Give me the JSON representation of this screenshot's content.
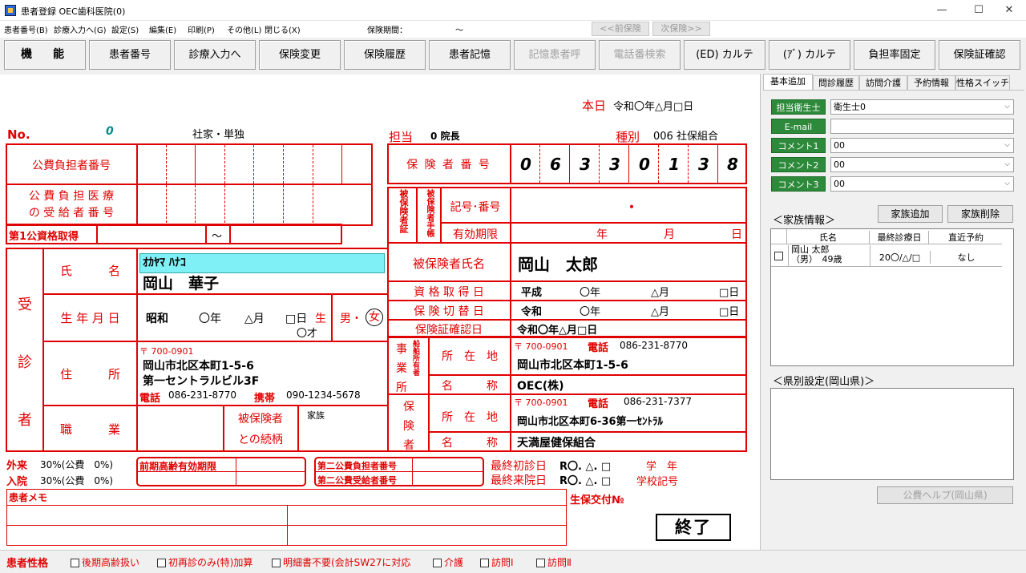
{
  "window": {
    "title": "患者登録  OEC歯科医院(0)",
    "min": "—",
    "max": "☐",
    "close": "✕"
  },
  "menu": {
    "items": [
      "患者番号(B)",
      "診療入力へ(G)",
      "設定(S)",
      "編集(E)",
      "印刷(P)",
      "その他(L)",
      "閉じる(X)"
    ],
    "period_label": "保険期間：",
    "period_sep": "～",
    "prev": "<<前保険",
    "next": "次保険>>"
  },
  "toolbar": {
    "function": "機　能",
    "buttons": [
      "患者番号",
      "診療入力へ",
      "保険変更",
      "保険履歴",
      "患者記憶",
      "記憶患者呼",
      "電話番検索",
      "(ED) カルテ",
      "(ｱﾞ) カルテ",
      "負担率固定",
      "保険証確認"
    ]
  },
  "header": {
    "today_label": "本日",
    "today_value": "令和〇年△月□日",
    "no_label": "No.",
    "no_value": "0",
    "type_left": "社家・単独",
    "tantou_label": "担当",
    "tantou_value": "0 院長",
    "shubetsu_label": "種別",
    "shubetsu_value": "006 社保組合"
  },
  "public": {
    "payer_label": "公費負担者番号",
    "recipient_label_1": "公 費 負 担 医 療",
    "recipient_label_2": "の 受 給 者 番 号",
    "first_label": "第1公資格取得",
    "first_sep": "～"
  },
  "insurer": {
    "label": "保 険 者 番 号",
    "digits": [
      "0",
      "6",
      "3",
      "3",
      "0",
      "1",
      "3",
      "8"
    ]
  },
  "insured": {
    "side_label": "被保険者証",
    "side_label2": "被保険者手帳",
    "kigo_label": "記号･番号",
    "kigo_value": "・",
    "valid_label": "有効期限",
    "valid_y": "年",
    "valid_m": "月",
    "valid_d": "日",
    "name_label": "被保険者氏名",
    "name_value": "岡山　太郎",
    "acq_label": "資 格 取 得 日",
    "acq_era": "平成",
    "acq_y": "〇年",
    "acq_m": "△月",
    "acq_d": "□日",
    "switch_label": "保 険 切 替 日",
    "sw_era": "令和",
    "sw_y": "〇年",
    "sw_m": "△月",
    "sw_d": "□日",
    "confirm_label": "保険証確認日",
    "confirm_value": "令和〇年△月□日"
  },
  "patient": {
    "side_label": [
      "受",
      "診",
      "者"
    ],
    "name_label": "氏　　　名",
    "kana_value": "ｵｶﾔﾏ ﾊﾅｺ",
    "name_value": "岡山　華子",
    "dob_label": "生 年 月 日",
    "dob_era": "昭和",
    "dob_y": "〇年",
    "dob_m": "△月",
    "dob_d": "□日",
    "dob_birth": "生",
    "age": "〇才",
    "sex_male": "男・",
    "sex_female": "女",
    "addr_label": "住　　　所",
    "zip": "〒 700-0901",
    "addr1": "岡山市北区本町1-5-6",
    "addr2": "第一セントラルビル3F",
    "tel_label": "電話",
    "tel_value": "086-231-8770",
    "mobile_label": "携帯",
    "mobile_value": "090-1234-5678",
    "job_label": "職　　　業",
    "relation_label_1": "被保険者",
    "relation_label_2": "との続柄",
    "relation_value": "家族"
  },
  "employer": {
    "side_label": [
      "事",
      "業",
      "所"
    ],
    "side_label2": "船舶所有者",
    "addr_label": "所　在　地",
    "zip": "〒 700-0901",
    "tel_label": "電話",
    "tel_value": "086-231-8770",
    "addr": "岡山市北区本町1-5-6",
    "name_label": "名　　　称",
    "name_value": "OEC(株)"
  },
  "insurer_info": {
    "side_label": [
      "保",
      "険",
      "者"
    ],
    "addr_label": "所　在　地",
    "zip": "〒 700-0901",
    "tel_label": "電話",
    "tel_value": "086-231-7377",
    "addr": "岡山市北区本町6-36第一ｾﾝﾄﾗﾙ",
    "name_label": "名　　　称",
    "name_value": "天満屋健保組合"
  },
  "bottom": {
    "gairai_label": "外来",
    "gairai_value": "30%(公費　0%)",
    "nyuin_label": "入院",
    "nyuin_value": "30%(公費　0%)",
    "koki_label": "前期高齢有効期限",
    "second_payer": "第二公費負担者番号",
    "second_recipient": "第二公費受給者番号",
    "last_first_label": "最終初診日",
    "last_first_value": "R〇. △. □",
    "last_visit_label": "最終来院日",
    "last_visit_value": "R〇. △. □",
    "gakunen": "学　年",
    "school": "学校記号",
    "memo_label": "患者メモ",
    "shiho": "生保交付№",
    "end_btn": "終了"
  },
  "right": {
    "tabs": [
      "基本追加",
      "問診履歴",
      "訪問介護",
      "予約情報",
      "性格スイッチ"
    ],
    "rows": [
      {
        "label": "担当衛生士",
        "value": "衛生士0"
      },
      {
        "label": "E-mail",
        "value": ""
      },
      {
        "label": "コメント1",
        "value": "00"
      },
      {
        "label": "コメント2",
        "value": "00"
      },
      {
        "label": "コメント3",
        "value": "00"
      }
    ],
    "family_label": "＜家族情報＞",
    "family_add": "家族追加",
    "family_del": "家族削除",
    "family_cols": [
      "氏名",
      "最終診療日",
      "直近予約"
    ],
    "family_row": {
      "name1": "岡山 太郎",
      "name2": "（男）　49歳",
      "last": "20〇/△/□",
      "next": "なし"
    },
    "pref_label": "＜県別設定(岡山県)＞",
    "kohi_help": "公費ヘルプ(岡山県)"
  },
  "traits": {
    "label": "患者性格",
    "items": [
      "後期高齢扱い",
      "初再診のみ(特)加算",
      "明細書不要(会計SW27に対応",
      "介護",
      "訪問Ⅰ",
      "訪問Ⅱ"
    ]
  }
}
